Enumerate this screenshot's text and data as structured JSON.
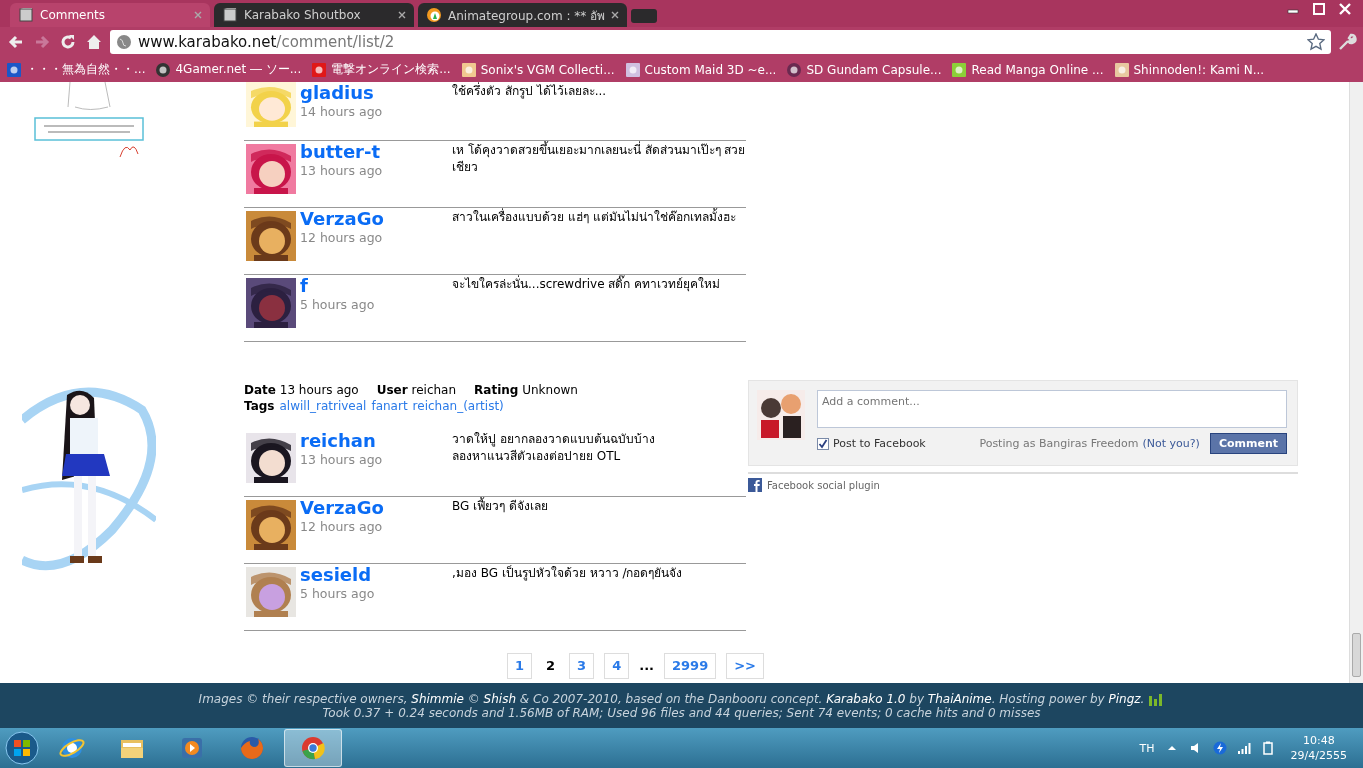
{
  "browser": {
    "tabs": [
      {
        "title": "Comments",
        "selected": true,
        "kind": "page"
      },
      {
        "title": "Karabako Shoutbox",
        "selected": false,
        "kind": "page"
      },
      {
        "title": "Animategroup.com : ** อัพ",
        "selected": false,
        "kind": "site"
      }
    ],
    "address": {
      "domain": "www.karabako.net",
      "path": "/comment/list/2"
    },
    "bookmarks": [
      {
        "title": "・・・無為自然・・..."
      },
      {
        "title": "4Gamer.net ― ソー..."
      },
      {
        "title": "電撃オンライン検索..."
      },
      {
        "title": "Sonix's VGM Collecti..."
      },
      {
        "title": "Custom Maid 3D ~e..."
      },
      {
        "title": "SD Gundam Capsule..."
      },
      {
        "title": "Read Manga Online ..."
      },
      {
        "title": "Shinnoden!: Kami N..."
      }
    ]
  },
  "posts": [
    {
      "comments": [
        {
          "user": "gladius",
          "time": "14 hours ago",
          "text": "ใช้ครึ่งตัว สักรูป ได้ไว้เลยละ..."
        },
        {
          "user": "butter-t",
          "time": "13 hours ago",
          "text": "เห โด้คุงวาดสวยขึ้นเยอะมากเลยนะนี่ สัดส่วนมาเป๊ะๆ สวยเชียว"
        },
        {
          "user": "VerzaGo",
          "time": "12 hours ago",
          "text": "สาวในเครื่องแบบด้วย แฮ่ๆ แต่มันไม่น่าใช่ค๊อกเทลมั้งฮะ"
        },
        {
          "user": "f",
          "time": "5 hours ago",
          "text": "จะไขใครล่ะนั่น...screwdrive สดิ๊ก คทาเวทย์ยุคใหม่"
        }
      ]
    },
    {
      "meta": [
        {
          "label": "Date",
          "value": "13 hours ago"
        },
        {
          "label": "User",
          "value": "reichan"
        },
        {
          "label": "Rating",
          "value": "Unknown"
        }
      ],
      "tags_label": "Tags",
      "tags": [
        "alwill_ratriveal",
        "fanart",
        "reichan_(artist)"
      ],
      "comments": [
        {
          "user": "reichan",
          "time": "13 hours ago",
          "text": "วาดให้ปู อยากลองวาดแบบต้นฉบับบ้าง\nลองหาแนวสีตัวเองต่อปายย OTL"
        },
        {
          "user": "VerzaGo",
          "time": "12 hours ago",
          "text": "BG เฟี้ยวๆ ดีจังเลย"
        },
        {
          "user": "sesield",
          "time": "5 hours ago",
          "text": ",มอง BG เป็นรูปหัวใจด้วย หวาว /กอดๆยันจัง"
        }
      ],
      "facebook": {
        "placeholder": "Add a comment...",
        "post_to_facebook": {
          "label": "Post to Facebook",
          "checked": true
        },
        "posting_as": "Posting as Bangiras Freedom",
        "not_you": "(Not you?)",
        "button": "Comment",
        "plugin": "Facebook social plugin"
      }
    }
  ],
  "pagination": [
    {
      "label": "1",
      "selected": false,
      "kind": "page"
    },
    {
      "label": "2",
      "selected": true,
      "kind": "page"
    },
    {
      "label": "3",
      "selected": false,
      "kind": "page"
    },
    {
      "label": "4",
      "selected": false,
      "kind": "page"
    },
    {
      "label": "...",
      "kind": "gap"
    },
    {
      "label": "2999",
      "selected": false,
      "kind": "page"
    },
    {
      "label": ">>",
      "selected": false,
      "kind": "page"
    }
  ],
  "footer": {
    "line1": [
      {
        "text": "Images © their respective owners, ",
        "link": false
      },
      {
        "text": "Shimmie",
        "link": true
      },
      {
        "text": " © ",
        "link": false
      },
      {
        "text": "Shish",
        "link": true
      },
      {
        "text": " & Co 2007-2010, based on the Danbooru concept. ",
        "link": false
      },
      {
        "text": "Karabako 1.0",
        "link": true
      },
      {
        "text": " by ",
        "link": false
      },
      {
        "text": "ThaiAnime",
        "link": true
      },
      {
        "text": ". Hosting power by ",
        "link": false
      },
      {
        "text": "Pingz",
        "link": true
      },
      {
        "text": ".",
        "link": false
      }
    ],
    "line2": "Took 0.37 + 0.24 seconds and 1.56MB of RAM; Used 96 files and 44 queries; Sent 74 events; 0 cache hits and 0 misses"
  },
  "taskbar": {
    "apps": [
      {
        "kind": "ie",
        "selected": false
      },
      {
        "kind": "folder",
        "selected": false
      },
      {
        "kind": "media",
        "selected": false
      },
      {
        "kind": "firefox",
        "selected": false
      },
      {
        "kind": "chrome",
        "selected": true
      }
    ],
    "language": "TH",
    "time": "10:48",
    "date": "29/4/2555"
  }
}
